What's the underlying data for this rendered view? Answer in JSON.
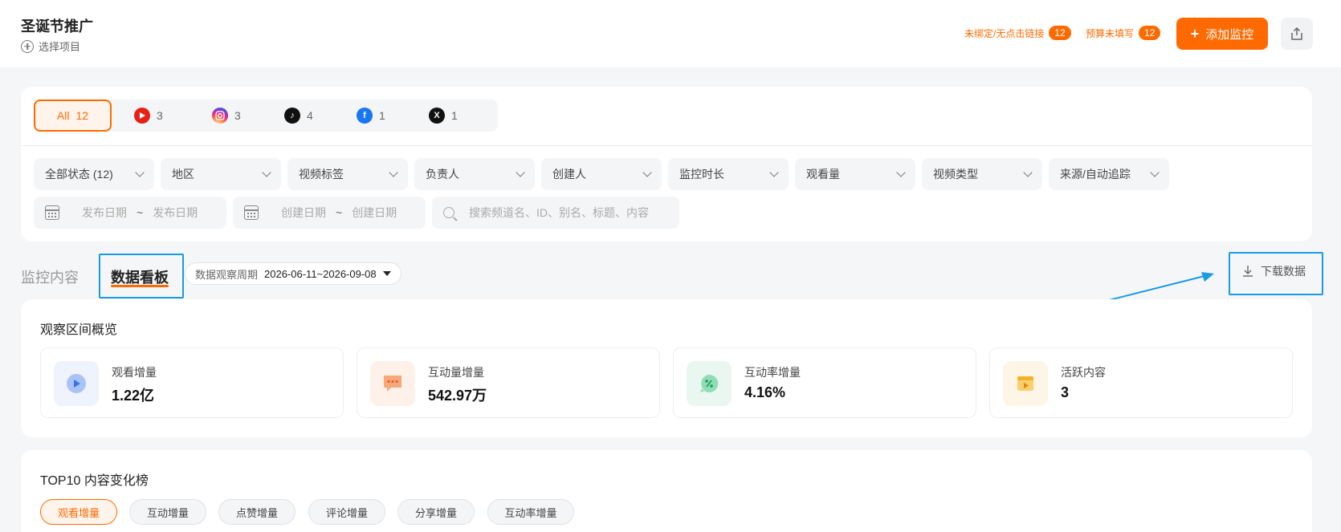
{
  "header": {
    "title": "圣诞节推广",
    "select_project": "选择项目",
    "warn_unbound": "未绑定/无点击链接",
    "warn_unbound_count": "12",
    "warn_budget": "预算未填写",
    "warn_budget_count": "12",
    "add_button": "添加监控",
    "add_plus": "+"
  },
  "platforms": [
    {
      "label": "All",
      "count": "12"
    },
    {
      "icon": "youtube-icon",
      "count": "3"
    },
    {
      "icon": "instagram-icon",
      "count": "3"
    },
    {
      "icon": "tiktok-icon",
      "count": "4"
    },
    {
      "icon": "facebook-icon",
      "count": "1"
    },
    {
      "icon": "x-icon",
      "count": "1"
    }
  ],
  "filters": {
    "status": "全部状态 (12)",
    "region": "地区",
    "video_tag": "视频标签",
    "owner": "负责人",
    "creator": "创建人",
    "duration": "监控时长",
    "views": "观看量",
    "video_type": "视频类型",
    "source": "来源/自动追踪",
    "publish_start": "发布日期",
    "publish_end": "发布日期",
    "create_start": "创建日期",
    "create_end": "创建日期",
    "tilde": "~",
    "search_placeholder": "搜索频道名、ID、别名、标题、内容"
  },
  "tabs": {
    "monitor": "监控内容",
    "board": "数据看板"
  },
  "period": {
    "label": "数据观察周期",
    "value": "2026-06-11~2026-09-08"
  },
  "download": "下载数据",
  "overview": {
    "title": "观察区间概览",
    "metrics": [
      {
        "label": "观看增量",
        "value": "1.22亿",
        "icon": "play-icon",
        "color": "#e9f0fd"
      },
      {
        "label": "互动量增量",
        "value": "542.97万",
        "icon": "chat-icon",
        "color": "#fdf1ea"
      },
      {
        "label": "互动率增量",
        "value": "4.16%",
        "icon": "percent-icon",
        "color": "#e8f7f0"
      },
      {
        "label": "活跃内容",
        "value": "3",
        "icon": "film-icon",
        "color": "#fdf6e7"
      }
    ]
  },
  "top10": {
    "title": "TOP10 内容变化榜",
    "pills": [
      "观看增量",
      "互动增量",
      "点赞增量",
      "评论增量",
      "分享增量",
      "互动率增量"
    ]
  }
}
